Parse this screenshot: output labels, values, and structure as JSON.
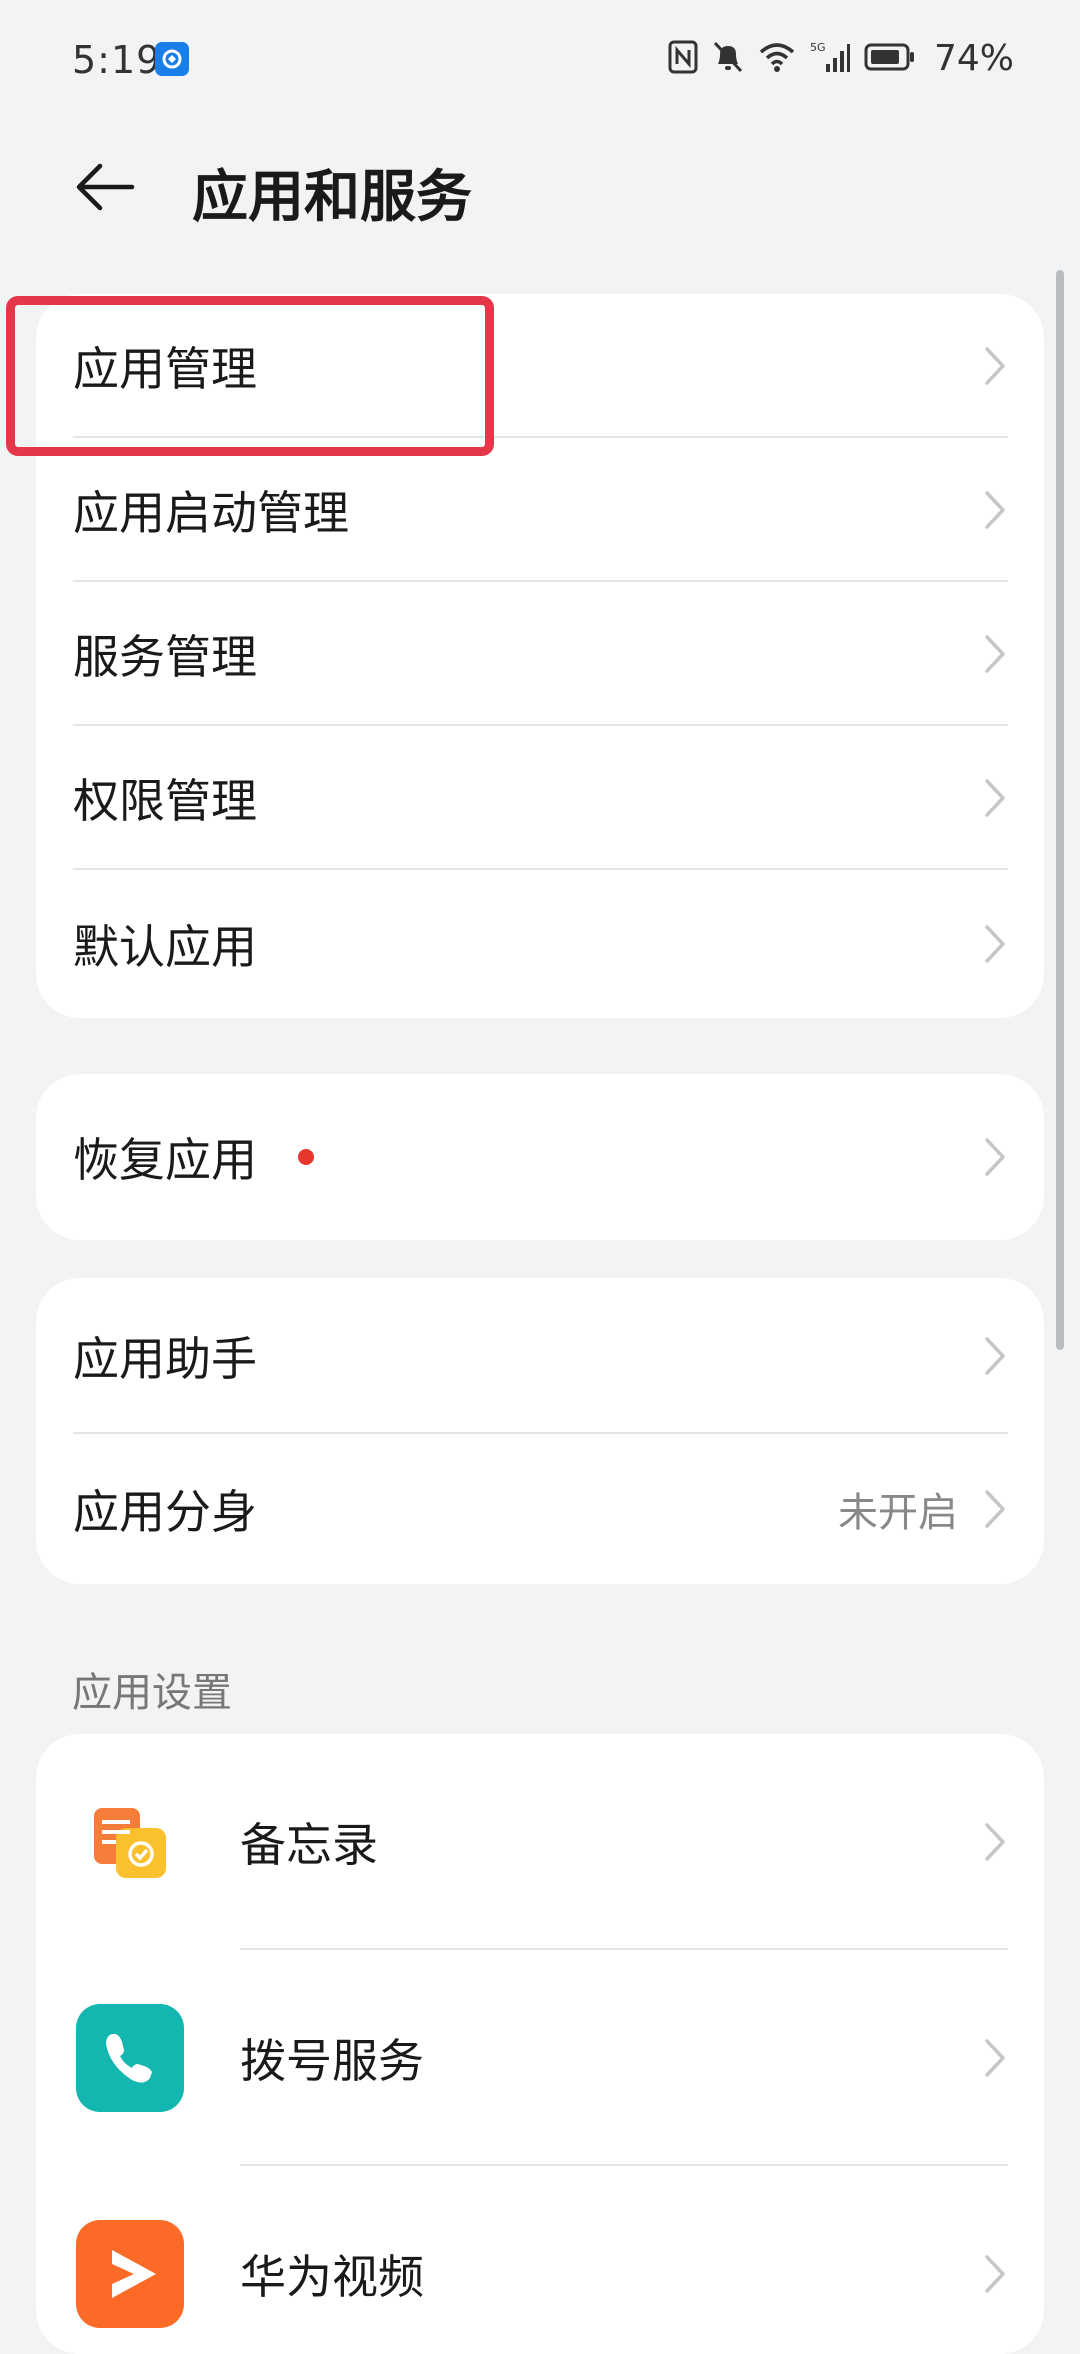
{
  "status_bar": {
    "time": "5:19",
    "battery": "74%",
    "icons": [
      "nfc-icon",
      "mute-bell-icon",
      "wifi-icon",
      "5g-signal-icon",
      "battery-icon"
    ]
  },
  "header": {
    "title": "应用和服务",
    "back_icon": "back-arrow-icon"
  },
  "group1": {
    "items": [
      {
        "label": "应用管理"
      },
      {
        "label": "应用启动管理"
      },
      {
        "label": "服务管理"
      },
      {
        "label": "权限管理"
      },
      {
        "label": "默认应用"
      }
    ]
  },
  "group2": {
    "items": [
      {
        "label": "恢复应用",
        "badge_color": "#e8382d"
      }
    ]
  },
  "group3": {
    "items": [
      {
        "label": "应用助手"
      },
      {
        "label": "应用分身",
        "value": "未开启"
      }
    ]
  },
  "app_settings": {
    "header": "应用设置",
    "items": [
      {
        "label": "备忘录",
        "icon": "notes-app-icon"
      },
      {
        "label": "拨号服务",
        "icon": "phone-app-icon"
      },
      {
        "label": "华为视频",
        "icon": "video-app-icon"
      }
    ]
  },
  "colors": {
    "background": "#f1f3f5",
    "card": "#ffffff",
    "highlight": "#e5374a",
    "phone_app": "#14b6b0",
    "video_app": "#fb6a26",
    "notes_app": "#f6a623"
  }
}
